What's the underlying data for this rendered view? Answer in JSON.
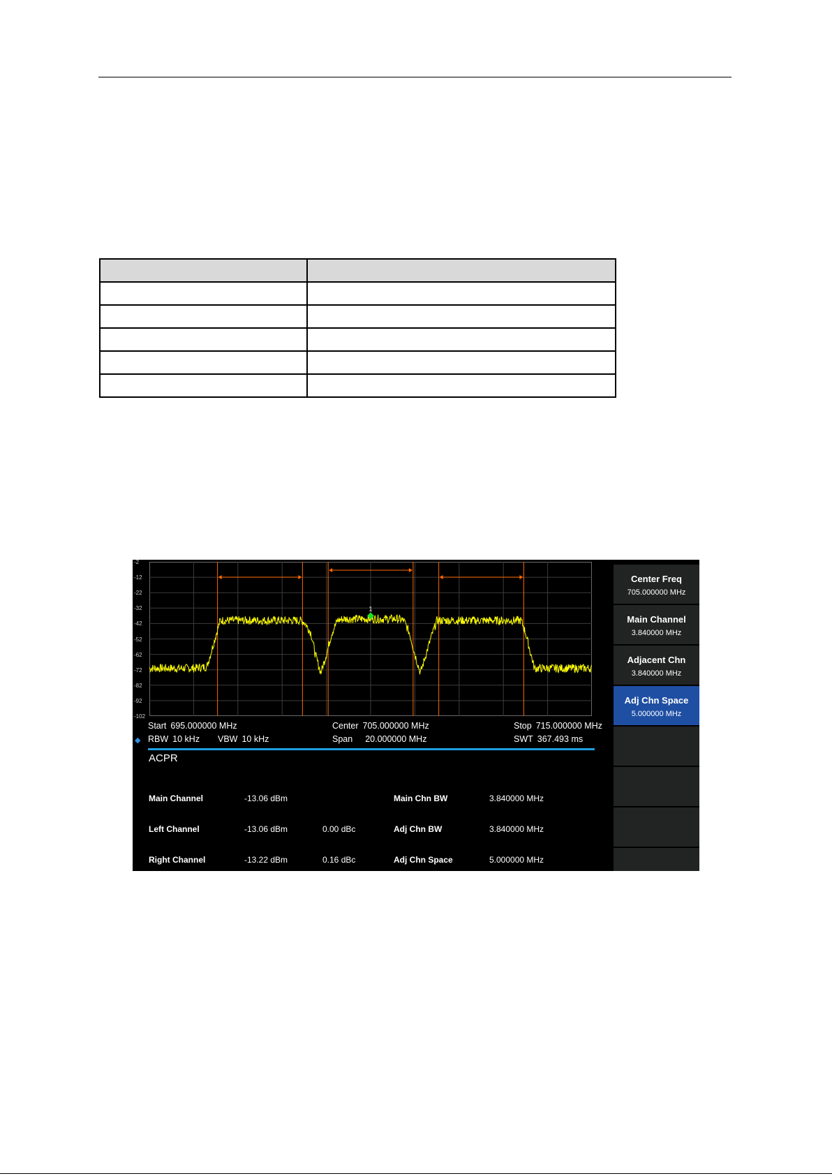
{
  "chart_data": {
    "type": "line",
    "y_ticks": [
      "-2",
      "-12",
      "-22",
      "-32",
      "-42",
      "-52",
      "-62",
      "-72",
      "-82",
      "-92",
      "-102"
    ],
    "ylim": [
      -102,
      -2
    ],
    "xlim": [
      695,
      715
    ],
    "grid": true,
    "trace_color": "#ffff00",
    "channel_marker_color": "#ff6a00",
    "marker": {
      "label": "1",
      "x": 705.0,
      "y": -37,
      "color": "#21e021"
    },
    "channels": [
      {
        "name": "left",
        "center": 700,
        "bw": 3.84
      },
      {
        "name": "main",
        "center": 705,
        "bw": 3.84
      },
      {
        "name": "right",
        "center": 710,
        "bw": 3.84
      }
    ],
    "trace_shape": {
      "x": [
        695.0,
        697.0,
        697.6,
        698.0,
        698.2,
        701.8,
        702.0,
        702.3,
        702.5,
        702.75,
        703.0,
        703.25,
        703.5,
        703.8,
        706.2,
        706.5,
        706.75,
        707.0,
        707.25,
        707.5,
        707.8,
        708.0,
        711.8,
        712.0,
        712.4,
        713.0,
        715.0
      ],
      "y": [
        -71,
        -71,
        -70,
        -50,
        -40,
        -40,
        -41,
        -48,
        -62,
        -74,
        -62,
        -48,
        -40,
        -39,
        -39,
        -40,
        -48,
        -62,
        -74,
        -62,
        -48,
        -40,
        -40,
        -48,
        -71,
        -71,
        -71
      ]
    }
  },
  "freq": {
    "start_label": "Start",
    "start_value": "695.000000 MHz",
    "center_label": "Center",
    "center_value": "705.000000 MHz",
    "stop_label": "Stop",
    "stop_value": "715.000000 MHz",
    "rbw_label": "RBW",
    "rbw_value": "10 kHz",
    "vbw_label": "VBW",
    "vbw_value": "10 kHz",
    "span_label": "Span",
    "span_value": "20.000000 MHz",
    "swt_label": "SWT",
    "swt_value": "367.493 ms"
  },
  "acpr": {
    "title": "ACPR",
    "rows": [
      {
        "name": "Main Channel",
        "power": "-13.06 dBm",
        "rel": "",
        "param": "Main Chn BW",
        "param_value": "3.840000 MHz"
      },
      {
        "name": "Left Channel",
        "power": "-13.06 dBm",
        "rel": "0.00 dBc",
        "param": "Adj Chn BW",
        "param_value": "3.840000 MHz"
      },
      {
        "name": "Right Channel",
        "power": "-13.22 dBm",
        "rel": "0.16 dBc",
        "param": "Adj Chn Space",
        "param_value": "5.000000 MHz"
      }
    ]
  },
  "softkeys": [
    {
      "title": "Center Freq",
      "value": "705.000000 MHz",
      "active": false
    },
    {
      "title": "Main Channel",
      "value": "3.840000 MHz",
      "active": false
    },
    {
      "title": "Adjacent Chn",
      "value": "3.840000 MHz",
      "active": false
    },
    {
      "title": "Adj Chn Space",
      "value": "5.000000 MHz",
      "active": true
    },
    {
      "title": "",
      "value": "",
      "active": false
    },
    {
      "title": "",
      "value": "",
      "active": false
    },
    {
      "title": "",
      "value": "",
      "active": false
    }
  ]
}
